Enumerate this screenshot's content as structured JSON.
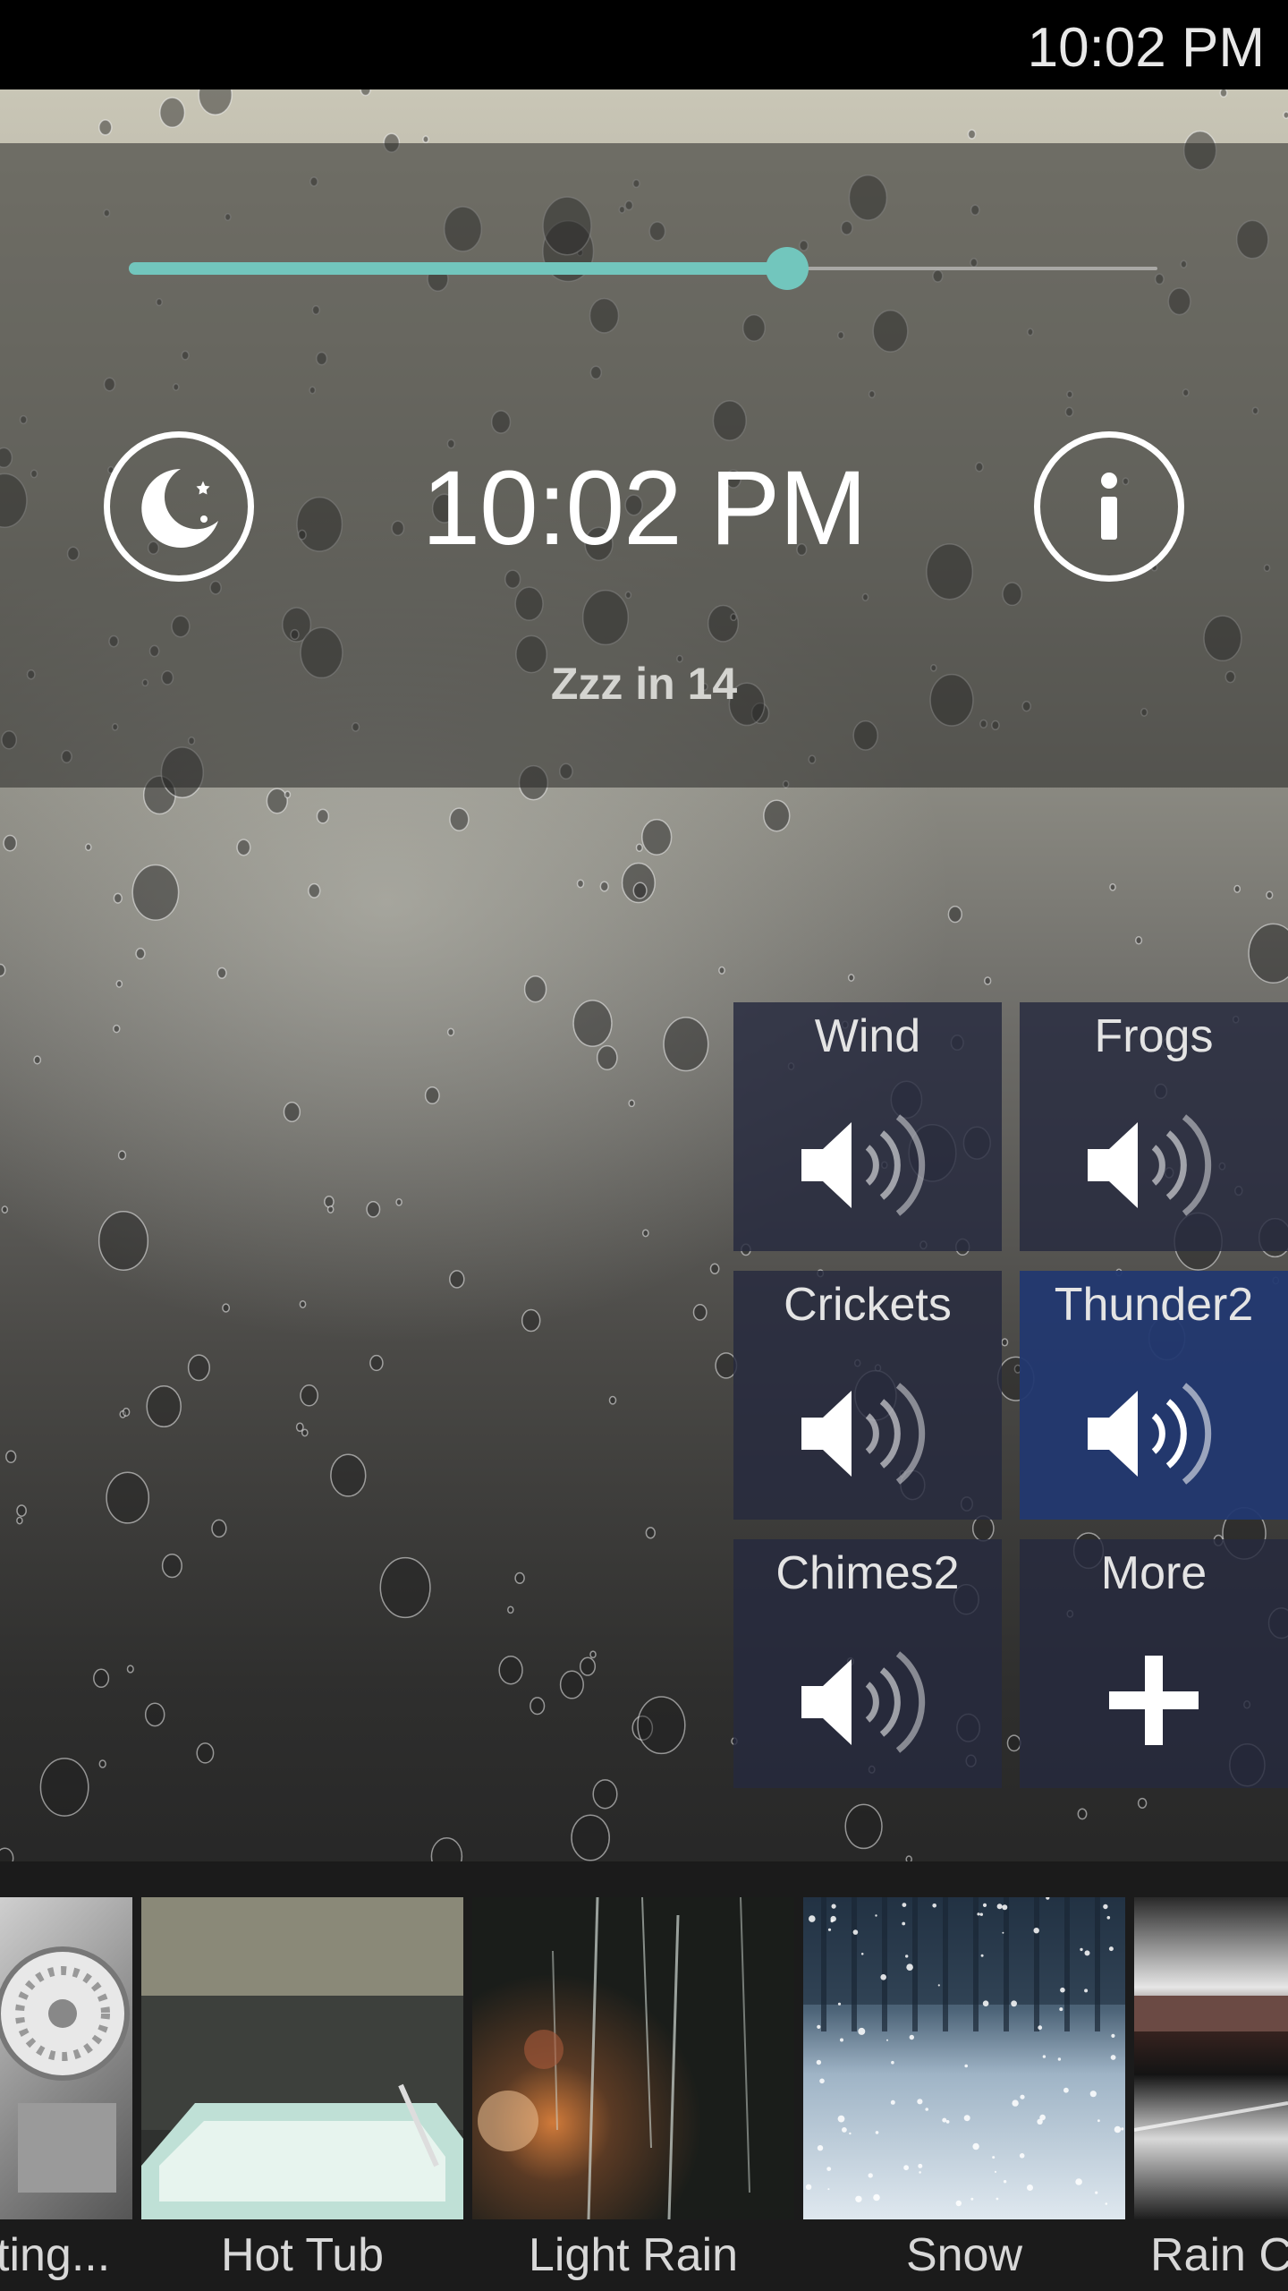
{
  "status_bar": {
    "time": "10:02 PM"
  },
  "player": {
    "volume_percent": 64,
    "sleep_button_icon": "moon-stars-icon",
    "info_button_icon": "info-icon",
    "clock": "10:02 PM",
    "sleep_status": "Zzz in 14"
  },
  "accent_color": "#72c6bd",
  "sound_tiles": [
    {
      "label": "Wind",
      "icon": "speaker-icon",
      "active": false
    },
    {
      "label": "Frogs",
      "icon": "speaker-icon",
      "active": false
    },
    {
      "label": "Crickets",
      "icon": "speaker-icon",
      "active": false
    },
    {
      "label": "Thunder2",
      "icon": "speaker-icon",
      "active": true
    },
    {
      "label": "Chimes2",
      "icon": "speaker-icon",
      "active": false
    },
    {
      "label": "More",
      "icon": "plus-icon",
      "active": false
    }
  ],
  "scenes": [
    {
      "label": "ting..."
    },
    {
      "label": "Hot Tub"
    },
    {
      "label": "Light Rain"
    },
    {
      "label": "Snow"
    },
    {
      "label": "Rain C"
    }
  ]
}
